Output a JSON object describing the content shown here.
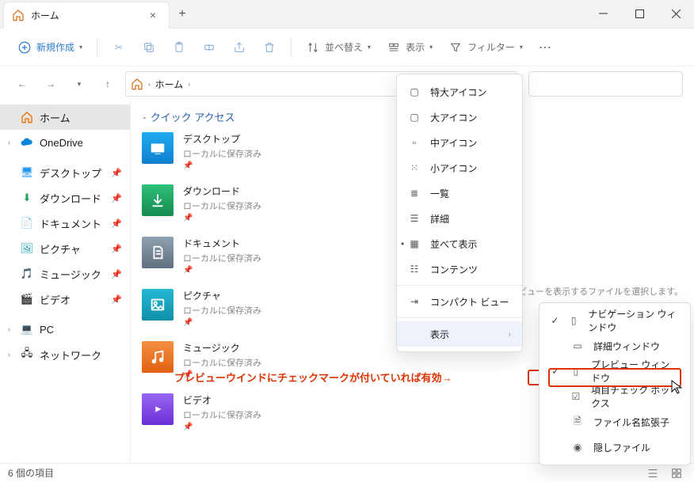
{
  "window": {
    "tab_title": "ホーム",
    "tab_close": "×",
    "new_tab": "+"
  },
  "toolbar": {
    "new_label": "新規作成",
    "sort_label": "並べ替え",
    "view_label": "表示",
    "filter_label": "フィルター",
    "more": "⋯"
  },
  "nav": {
    "back": "←",
    "forward": "→",
    "up": "↑",
    "breadcrumb": "ホーム",
    "sep": "›"
  },
  "sidebar": {
    "home": "ホーム",
    "onedrive": "OneDrive",
    "pins": [
      {
        "icon": "desktop",
        "label": "デスクトップ"
      },
      {
        "icon": "download",
        "label": "ダウンロード"
      },
      {
        "icon": "document",
        "label": "ドキュメント"
      },
      {
        "icon": "picture",
        "label": "ピクチャ"
      },
      {
        "icon": "music",
        "label": "ミュージック"
      },
      {
        "icon": "video",
        "label": "ビデオ"
      }
    ],
    "pc": "PC",
    "network": "ネットワーク"
  },
  "section": {
    "quickaccess": "クイック アクセス"
  },
  "items": [
    {
      "title": "デスクトップ",
      "sub": "ローカルに保存済み"
    },
    {
      "title": "ダウンロード",
      "sub": "ローカルに保存済み"
    },
    {
      "title": "ドキュメント",
      "sub": "ローカルに保存済み"
    },
    {
      "title": "ピクチャ",
      "sub": "ローカルに保存済み"
    },
    {
      "title": "ミュージック",
      "sub": "ローカルに保存済み"
    },
    {
      "title": "ビデオ",
      "sub": "ローカルに保存済み"
    }
  ],
  "pin_glyph": "📌",
  "preview_hint": "ビューを表示するファイルを選択します。",
  "menu_view": [
    {
      "label": "特大アイコン"
    },
    {
      "label": "大アイコン"
    },
    {
      "label": "中アイコン"
    },
    {
      "label": "小アイコン"
    },
    {
      "label": "一覧"
    },
    {
      "label": "詳細"
    },
    {
      "label": "並べて表示"
    },
    {
      "label": "コンテンツ"
    }
  ],
  "menu_view_compact": "コンパクト ビュー",
  "menu_view_show": "表示",
  "menu_show": [
    {
      "chk": true,
      "label": "ナビゲーション ウィンドウ"
    },
    {
      "chk": false,
      "label": "詳細ウィンドウ"
    },
    {
      "chk": true,
      "label": "プレビュー ウィンドウ"
    },
    {
      "chk": false,
      "label": "項目チェック ボックス"
    },
    {
      "chk": false,
      "label": "ファイル名拡張子"
    },
    {
      "chk": false,
      "label": "隠しファイル"
    }
  ],
  "annotation": "プレビューウインドにチェックマークが付いていれば有効→",
  "status": {
    "count": "6 個の項目"
  }
}
